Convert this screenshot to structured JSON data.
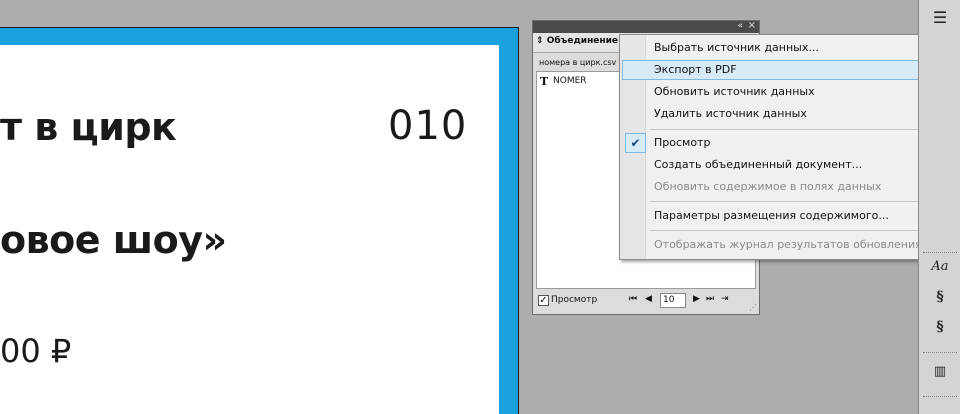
{
  "document": {
    "line1": "т в цирк",
    "number": "010",
    "line2": "овое шоу»",
    "price": "00 ₽"
  },
  "panel": {
    "tab_title": "Объединение д",
    "collapse_icon": "«",
    "close_icon": "×",
    "file_name": "номера в цирк.csv",
    "fields": [
      {
        "type_icon": "T",
        "name": "NOMER"
      }
    ],
    "footer": {
      "preview_label": "Просмотр",
      "record_value": "10"
    }
  },
  "menu": {
    "items": [
      {
        "label": "Выбрать источник данных...",
        "state": "normal"
      },
      {
        "label": "Экспорт в PDF",
        "state": "highlighted"
      },
      {
        "label": "Обновить источник данных",
        "state": "normal"
      },
      {
        "label": "Удалить источник данных",
        "state": "normal"
      },
      {
        "label": "Просмотр",
        "state": "checked"
      },
      {
        "label": "Создать объединенный документ...",
        "state": "normal"
      },
      {
        "label": "Обновить содержимое в полях данных",
        "state": "disabled"
      },
      {
        "label": "Параметры размещения содержимого...",
        "state": "normal"
      },
      {
        "label": "Отображать журнал результатов обновления",
        "state": "disabled"
      }
    ]
  },
  "dock": {
    "icons": [
      "menu-icon",
      "character-styles-icon",
      "paragraph-styles-icon",
      "object-styles-icon",
      "library-icon"
    ]
  },
  "colors": {
    "bleed": "#1aa1dc",
    "menu_highlight": "#d6eaf8",
    "menu_highlight_border": "#7fb8e0"
  }
}
